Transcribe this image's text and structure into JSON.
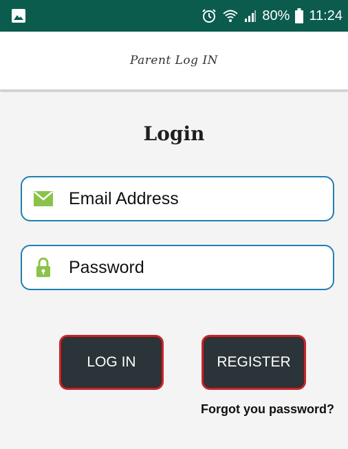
{
  "status_bar": {
    "battery": "80%",
    "time": "11:24",
    "icons": [
      "gallery-icon",
      "alarm-icon",
      "wifi-icon",
      "signal-icon",
      "battery-icon"
    ]
  },
  "app_bar": {
    "title": "Parent Log IN"
  },
  "login": {
    "heading": "Login",
    "email_placeholder": "Email Address",
    "password_placeholder": "Password",
    "login_button": "LOG IN",
    "register_button": "REGISTER",
    "forgot_link": "Forgot you password?"
  },
  "colors": {
    "status_bar": "#0b5c4d",
    "field_border": "#1e7eb3",
    "button_bg": "#2b3438",
    "button_border": "#c0282e",
    "icon_green": "#8bc34a"
  }
}
